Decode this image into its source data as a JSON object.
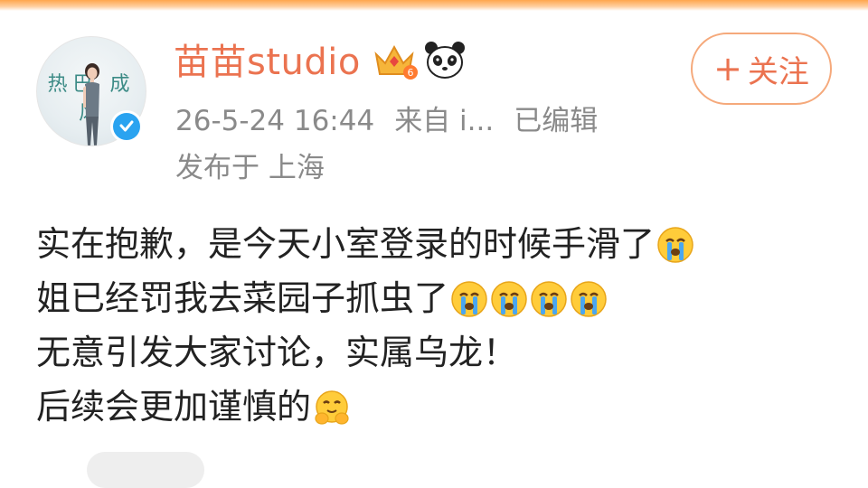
{
  "post": {
    "author_name": "苗苗studio",
    "avatar_text": "热巴 成风",
    "timestamp": "26-5-24 16:44",
    "source": "来自 i...",
    "edited": "已编辑",
    "location": "发布于 上海",
    "follow_label": "关注",
    "follow_plus": "+",
    "lines": [
      "实在抱歉，是今天小室登录的时候手滑了",
      "姐已经罚我去菜园子抓虫了",
      "无意引发大家讨论，实属乌龙！",
      "后续会更加谨慎的"
    ],
    "line_emojis": [
      [
        "crying-face"
      ],
      [
        "crying-face",
        "crying-face",
        "crying-face",
        "crying-face"
      ],
      [],
      [
        "hugging-face"
      ]
    ]
  },
  "colors": {
    "name": "#eb7350",
    "meta": "#8a8a8a",
    "follow_border": "#f5a97b",
    "verified": "#2aa3f0",
    "text": "#222222"
  },
  "icons": [
    "verified-badge-icon",
    "crown-level-icon",
    "panda-icon",
    "crying-face-emoji",
    "hugging-face-emoji"
  ]
}
